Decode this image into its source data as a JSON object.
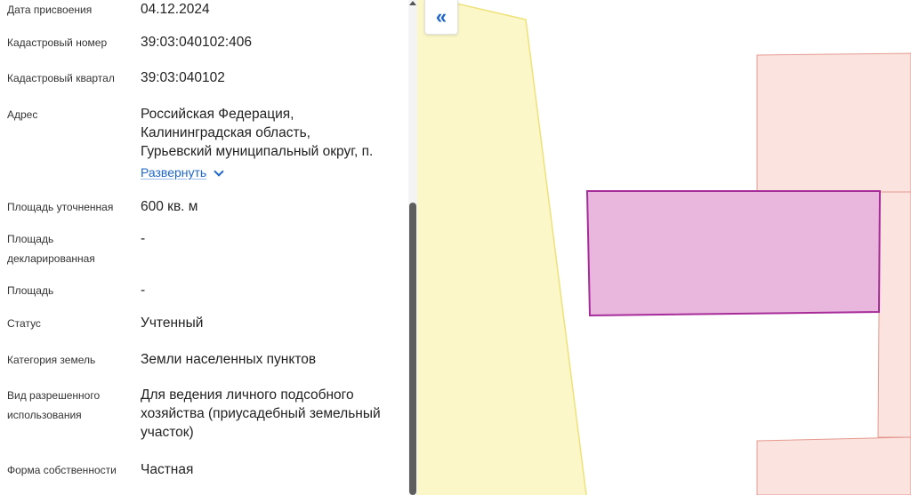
{
  "fields": [
    {
      "label": "Дата присвоения",
      "value": "04.12.2024"
    },
    {
      "label": "Кадастровый номер",
      "value": "39:03:040102:406"
    },
    {
      "label": "Кадастровый квартал",
      "value": "39:03:040102"
    },
    {
      "label": "Адрес",
      "value_lines": [
        "Российская Федерация,",
        "Калининградская область,",
        "Гурьевский муниципальный округ, п."
      ],
      "link": "Развернуть"
    },
    {
      "label": "Площадь уточненная",
      "value": "600 кв. м"
    },
    {
      "label_lines": [
        "Площадь",
        "декларированная"
      ],
      "value": "-"
    },
    {
      "label": "Площадь",
      "value": "-"
    },
    {
      "label": "Статус",
      "value": "Учтенный"
    },
    {
      "label": "Категория земель",
      "value": "Земли населенных пунктов"
    },
    {
      "label_lines": [
        "Вид разрешенного",
        "использования"
      ],
      "value_lines": [
        "Для ведения личного подсобного",
        "хозяйства (приусадебный земельный",
        "участок)"
      ]
    },
    {
      "label": "Форма собственности",
      "value": "Частная"
    }
  ],
  "map": {
    "collapse_icon": "double-chevron-left-icon",
    "collapse_glyph": "«",
    "colors": {
      "yellow_zone_fill": "#fbf7c8",
      "yellow_zone_stroke": "#ede27a",
      "neighbor_fill": "#fbe3df",
      "neighbor_stroke": "#e59a8e",
      "selected_fill": "#e9b6dd",
      "selected_stroke": "#a62c9a",
      "accent": "#1f66c9"
    }
  }
}
